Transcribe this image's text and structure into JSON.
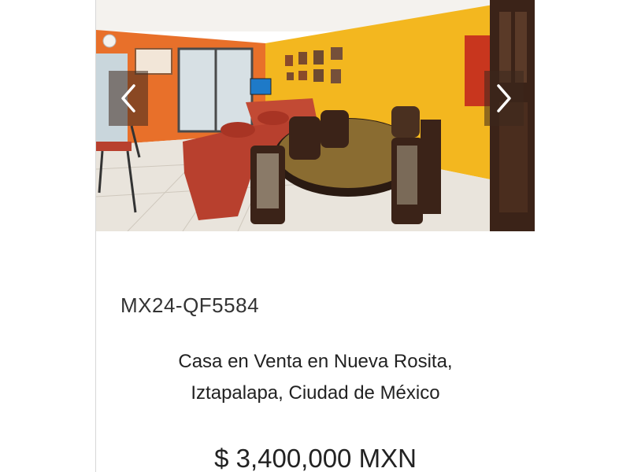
{
  "listing": {
    "code": "MX24-QF5584",
    "title_line1": "Casa en Venta en Nueva Rosita,",
    "title_line2": "Iztapalapa, Ciudad de México",
    "price": "$ 3,400,000 MXN"
  },
  "carousel": {
    "prev_icon": "chevron-left-icon",
    "next_icon": "chevron-right-icon"
  },
  "colors": {
    "orange_wall": "#e8702a",
    "yellow_wall": "#f3b71f",
    "sofa": "#b8402e",
    "wood": "#3b2318",
    "floor": "#e9e4dc"
  }
}
